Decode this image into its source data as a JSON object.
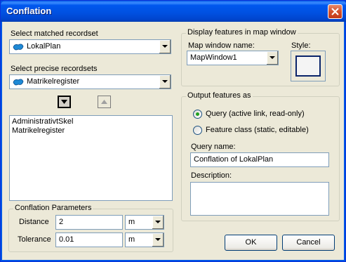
{
  "window": {
    "title": "Conflation"
  },
  "matched": {
    "label": "Select matched recordset",
    "value": "LokalPlan"
  },
  "precise": {
    "label": "Select precise recordsets",
    "value": "Matrikelregister",
    "list": [
      "AdministrativtSkel",
      "Matrikelregister"
    ]
  },
  "params": {
    "legend": "Conflation Parameters",
    "distance_label": "Distance",
    "distance_value": "2",
    "distance_unit": "m",
    "tolerance_label": "Tolerance",
    "tolerance_value": "0.01",
    "tolerance_unit": "m"
  },
  "display": {
    "legend": "Display features in map window",
    "map_window_label": "Map window name:",
    "map_window_value": "MapWindow1",
    "style_label": "Style:"
  },
  "output": {
    "legend": "Output features as",
    "query_option": "Query (active link, read-only)",
    "feature_option": "Feature class (static, editable)",
    "selected": "query",
    "query_name_label": "Query name:",
    "query_name_value": "Conflation of  LokalPlan",
    "description_label": "Description:",
    "description_value": ""
  },
  "buttons": {
    "ok": "OK",
    "cancel": "Cancel"
  },
  "icons": {
    "close": "close-icon",
    "recordset": "recordset-icon",
    "move_down": "arrow-down-icon",
    "move_up": "arrow-up-icon"
  },
  "colors": {
    "titlebar": "#0055e5",
    "dialog_bg": "#ece9d8",
    "close_button": "#d2502c",
    "radio_checked": "#21a121"
  }
}
